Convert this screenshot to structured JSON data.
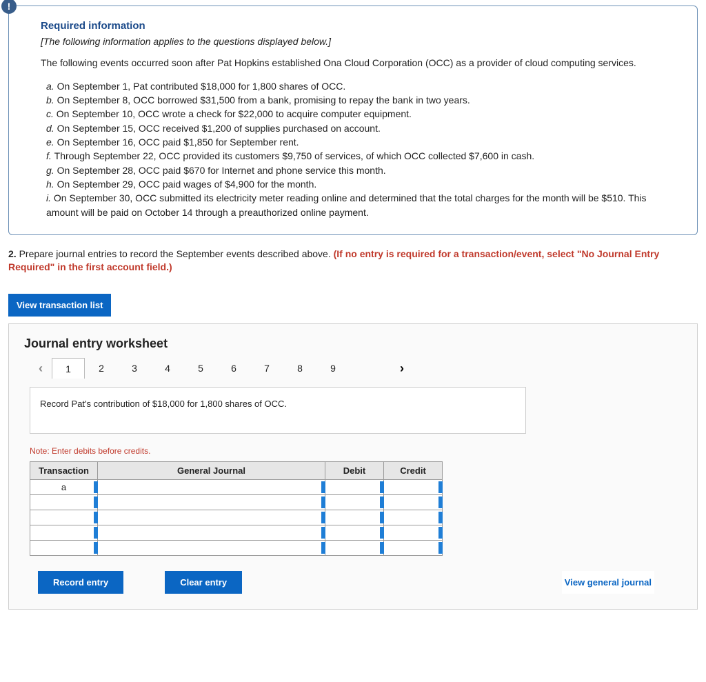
{
  "info": {
    "icon_glyph": "!",
    "title": "Required information",
    "italic_note": "[The following information applies to the questions displayed below.]",
    "intro": "The following events occurred soon after Pat Hopkins established Ona Cloud Corporation (OCC) as a provider of cloud computing services.",
    "events": [
      {
        "label": "a.",
        "text": "On September 1, Pat contributed $18,000 for 1,800 shares of OCC."
      },
      {
        "label": "b.",
        "text": "On September 8, OCC borrowed $31,500 from a bank, promising to repay the bank in two years."
      },
      {
        "label": "c.",
        "text": "On September 10, OCC wrote a check for $22,000 to acquire computer equipment."
      },
      {
        "label": "d.",
        "text": "On September 15, OCC received $1,200 of supplies purchased on account."
      },
      {
        "label": "e.",
        "text": "On September 16, OCC paid $1,850 for September rent."
      },
      {
        "label": "f.",
        "text": "Through September 22, OCC provided its customers $9,750 of services, of which OCC collected $7,600 in cash."
      },
      {
        "label": "g.",
        "text": "On September 28, OCC paid $670 for Internet and phone service this month."
      },
      {
        "label": "h.",
        "text": "On September 29, OCC paid wages of $4,900 for the month."
      },
      {
        "label": "i.",
        "text": "On September 30, OCC submitted its electricity meter reading online and determined that the total charges for the month will be $510. This amount will be paid on October 14 through a preauthorized online payment."
      }
    ]
  },
  "question": {
    "number": "2.",
    "text_plain": "Prepare journal entries to record the September events described above. ",
    "text_red": "(If no entry is required for a transaction/event, select \"No Journal Entry Required\" in the first account field.)"
  },
  "buttons": {
    "view_transactions": "View transaction list",
    "record": "Record entry",
    "clear": "Clear entry",
    "view_journal": "View general journal"
  },
  "worksheet": {
    "title": "Journal entry worksheet",
    "tabs": [
      "1",
      "2",
      "3",
      "4",
      "5",
      "6",
      "7",
      "8",
      "9"
    ],
    "active_tab": "1",
    "prompt": "Record Pat's contribution of $18,000 for 1,800 shares of OCC.",
    "note": "Note: Enter debits before credits.",
    "columns": {
      "tx": "Transaction",
      "gj": "General Journal",
      "db": "Debit",
      "cr": "Credit"
    },
    "rows": [
      {
        "tx": "a",
        "gj": "",
        "db": "",
        "cr": ""
      },
      {
        "tx": "",
        "gj": "",
        "db": "",
        "cr": ""
      },
      {
        "tx": "",
        "gj": "",
        "db": "",
        "cr": ""
      },
      {
        "tx": "",
        "gj": "",
        "db": "",
        "cr": ""
      },
      {
        "tx": "",
        "gj": "",
        "db": "",
        "cr": ""
      }
    ]
  }
}
